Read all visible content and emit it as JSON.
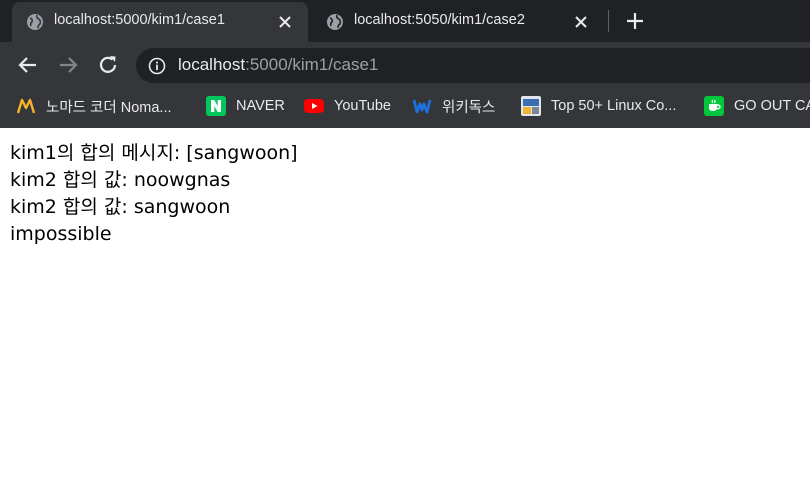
{
  "tabs": [
    {
      "title": "localhost:5000/kim1/case1",
      "favicon": "globe-icon",
      "active": true
    },
    {
      "title": "localhost:5050/kim1/case2",
      "favicon": "globe-icon",
      "active": false
    }
  ],
  "omnibox": {
    "host": "localhost",
    "path": ":5000/kim1/case1"
  },
  "bookmarks": [
    {
      "label": "노마드 코더 Noma...",
      "icon": "nomad-coder-icon"
    },
    {
      "label": "NAVER",
      "icon": "naver-icon"
    },
    {
      "label": "YouTube",
      "icon": "youtube-icon"
    },
    {
      "label": "위키독스",
      "icon": "wikidocs-icon"
    },
    {
      "label": "Top 50+ Linux Co...",
      "icon": "linux-site-icon"
    },
    {
      "label": "GO OUT CA",
      "icon": "go-out-camping-icon"
    }
  ],
  "content": {
    "lines": [
      "kim1의 합의 메시지: [sangwoon]",
      "kim2 합의 값: noowgnas",
      "kim2 합의 값: sangwoon",
      "impossible"
    ]
  },
  "colors": {
    "tabstrip": "#202124",
    "toolbar": "#35363a",
    "omnibox": "#202124",
    "text_light": "#e8eaed",
    "text_dim": "#9aa0a6"
  }
}
